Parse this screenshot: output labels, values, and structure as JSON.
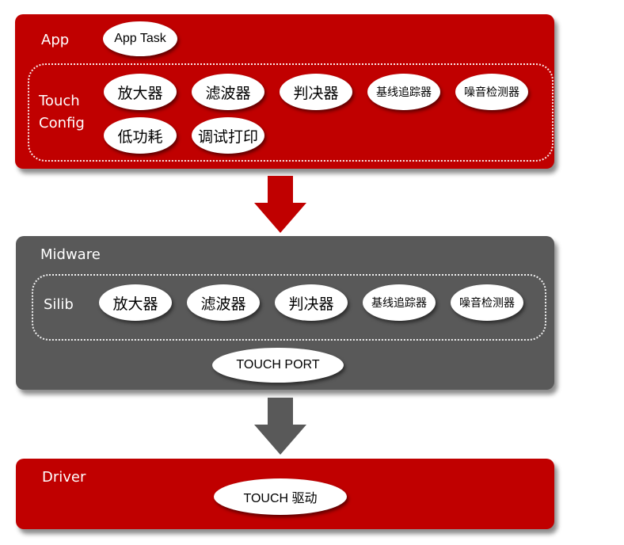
{
  "colors": {
    "app_layer": "#c00000",
    "midware_layer": "#595959",
    "driver_layer": "#c00000",
    "node_fill": "#ffffff"
  },
  "app_layer": {
    "label": "App",
    "task": "App Task",
    "group_label_line1": "Touch",
    "group_label_line2": "Config",
    "row1": [
      "放大器",
      "滤波器",
      "判决器",
      "基线追踪器",
      "噪音检测器"
    ],
    "row2": [
      "低功耗",
      "调试打印"
    ]
  },
  "midware_layer": {
    "label": "Midware",
    "group_label": "Silib",
    "items": [
      "放大器",
      "滤波器",
      "判决器",
      "基线追踪器",
      "噪音检测器"
    ],
    "port": "TOUCH PORT"
  },
  "driver_layer": {
    "label": "Driver",
    "driver": "TOUCH 驱动"
  },
  "arrows": [
    {
      "from": "App",
      "to": "Midware",
      "color": "#c00000",
      "icon": "arrow-down-icon"
    },
    {
      "from": "Midware",
      "to": "Driver",
      "color": "#595959",
      "icon": "arrow-down-icon"
    }
  ]
}
